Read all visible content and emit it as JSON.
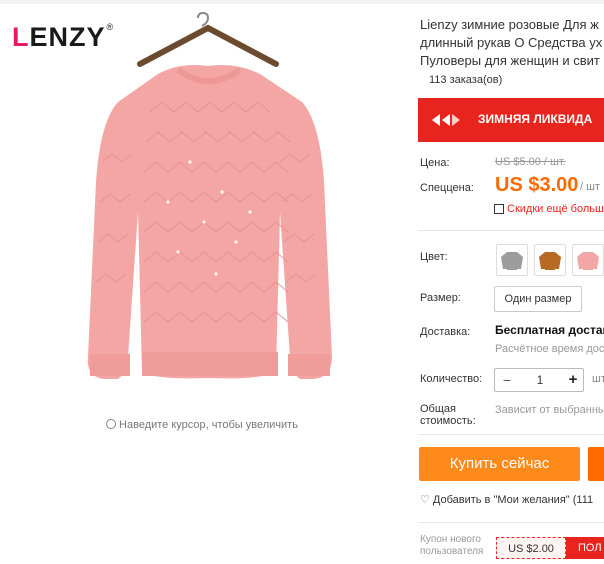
{
  "brand": {
    "logo_text": "LIENZY",
    "logo_mark": "®"
  },
  "gallery": {
    "zoom_hint": "Наведите курсор, чтобы увеличить"
  },
  "product": {
    "title_line1": "Lienzy зимние розовые Для ж",
    "title_line2": "длинный рукав О Средства ух",
    "title_line3": "Пуловеры для женщин и свит",
    "orders": "113 заказа(ов)"
  },
  "promo_banner": {
    "text": "ЗИМНЯЯ ЛИКВИДА",
    "color": "#e8241f"
  },
  "price": {
    "old_label": "Цена:",
    "old_value": "US $5.00 / шт.",
    "special_label": "Спеццена:",
    "special_value": "US $3.00",
    "per_unit": "/ шт",
    "discount_text": "Скидки ещё больш",
    "accent_color": "#ff6a00"
  },
  "options": {
    "color_label": "Цвет:",
    "color_swatches": [
      "gray-sweater",
      "brown-sweater",
      "pink-sweater"
    ],
    "size_label": "Размер:",
    "size_value": "Один размер"
  },
  "shipping": {
    "label": "Доставка:",
    "free": "Бесплатная доставк",
    "time": "Расчётное время дос"
  },
  "quantity": {
    "label": "Количество:",
    "minus": "−",
    "value": "1",
    "plus": "+",
    "unit": "шт"
  },
  "total": {
    "label_line1": "Общая",
    "label_line2": "стоимость:",
    "value": "Зависит от выбранны"
  },
  "actions": {
    "buy_now": "Купить сейчас",
    "wishlist": "Добавить в \"Мои желания\" (111"
  },
  "coupon": {
    "label_line1": "Купон нового",
    "label_line2": "пользователя",
    "amount": "US $2.00",
    "get_label": "ПОЛ"
  }
}
